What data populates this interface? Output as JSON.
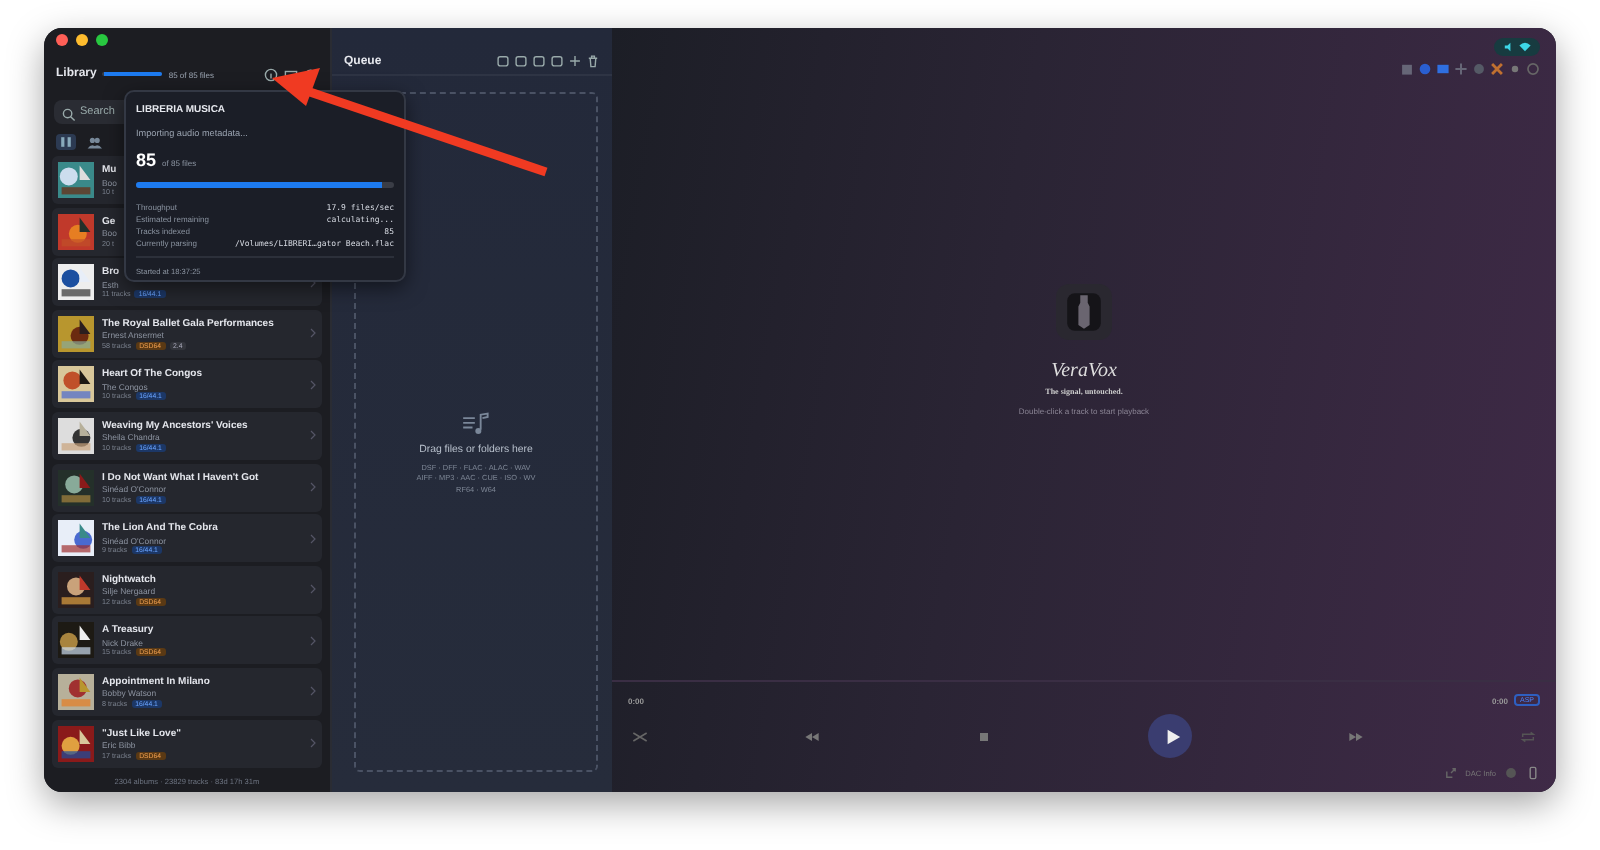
{
  "library": {
    "title": "Library",
    "progress": {
      "level": 1,
      "label": "85 of 85 files"
    },
    "search": {
      "placeholder": "Search"
    },
    "albums": [
      {
        "title": "Mu",
        "artist": "Boo",
        "tracks": "10 t"
      },
      {
        "title": "Ge",
        "artist": "Boo",
        "tracks": "20 t"
      },
      {
        "title": "Bro",
        "artist": "Esth",
        "tracks": "11 tracks",
        "badges": [
          {
            "text": "16/44.1",
            "kind": "pcm"
          }
        ]
      },
      {
        "title": "The Royal Ballet Gala Performances",
        "artist": "Ernest Ansermet",
        "tracks": "58 tracks",
        "badges": [
          {
            "text": "DSD64",
            "kind": "dsd"
          },
          {
            "text": "2.4",
            "kind": "other"
          }
        ]
      },
      {
        "title": "Heart Of The Congos",
        "artist": "The Congos",
        "tracks": "10 tracks",
        "badges": [
          {
            "text": "16/44.1",
            "kind": "pcm"
          }
        ]
      },
      {
        "title": "Weaving My Ancestors' Voices",
        "artist": "Sheila Chandra",
        "tracks": "10 tracks",
        "badges": [
          {
            "text": "16/44.1",
            "kind": "pcm"
          }
        ]
      },
      {
        "title": "I Do Not Want What I Haven't Got",
        "artist": "Sinéad O'Connor",
        "tracks": "10 tracks",
        "badges": [
          {
            "text": "16/44.1",
            "kind": "pcm"
          }
        ]
      },
      {
        "title": "The Lion And The Cobra",
        "artist": "Sinéad O'Connor",
        "tracks": "9 tracks",
        "badges": [
          {
            "text": "16/44.1",
            "kind": "pcm"
          }
        ]
      },
      {
        "title": "Nightwatch",
        "artist": "Silje Nergaard",
        "tracks": "12 tracks",
        "badges": [
          {
            "text": "DSD64",
            "kind": "dsd"
          }
        ]
      },
      {
        "title": "A Treasury",
        "artist": "Nick Drake",
        "tracks": "15 tracks",
        "badges": [
          {
            "text": "DSD64",
            "kind": "dsd"
          }
        ]
      },
      {
        "title": "Appointment In Milano",
        "artist": "Bobby Watson",
        "tracks": "8 tracks",
        "badges": [
          {
            "text": "16/44.1",
            "kind": "pcm"
          }
        ]
      },
      {
        "title": "\"Just Like Love\"",
        "artist": "Eric Bibb",
        "tracks": "17 tracks",
        "badges": [
          {
            "text": "DSD64",
            "kind": "dsd"
          }
        ]
      }
    ],
    "footer": "2304 albums · 23829 tracks · 83d 17h 31m"
  },
  "import_popup": {
    "title": "LIBRERIA MUSICA",
    "status": "Importing audio metadata...",
    "count": "85",
    "count_label": "of 85 files",
    "progress": {
      "level": 0.95
    },
    "stats": [
      {
        "label": "Throughput",
        "value": "17.9 files/sec"
      },
      {
        "label": "Estimated remaining",
        "value": "calculating..."
      },
      {
        "label": "Tracks indexed",
        "value": "85"
      },
      {
        "label": "Currently parsing",
        "value": "/Volumes/LIBRERI…gator Beach.flac"
      }
    ],
    "started": "Started at 18:37:25"
  },
  "queue": {
    "title": "Queue",
    "drop_title": "Drag files or folders here",
    "formats": [
      "DSF · DFF · FLAC · ALAC · WAV",
      "AIFF · MP3 · AAC · CUE · ISO · WV",
      "RF64 · W64"
    ]
  },
  "now_playing": {
    "app_name": "VeraVox",
    "tagline": "The signal, untouched.",
    "hint": "Double-click a track to start playback"
  },
  "player": {
    "elapsed": "0:00",
    "remaining": "0:00",
    "output_badge": "ASP",
    "dac_label": "DAC Info"
  }
}
